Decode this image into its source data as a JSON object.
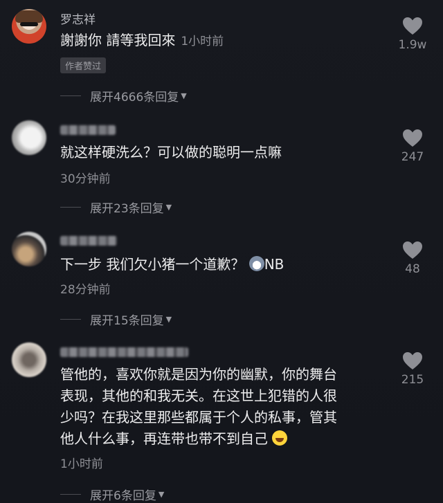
{
  "comments": [
    {
      "username": "罗志祥",
      "text": "謝謝你 請等我回來",
      "time": "1小时前",
      "badge": "作者赞过",
      "expand": "展开4666条回复",
      "likes": "1.9w"
    },
    {
      "username": "",
      "text": "就这样硬洗么？可以做的聪明一点嘛",
      "time": "30分钟前",
      "expand": "展开23条回复",
      "likes": "247"
    },
    {
      "username": "",
      "text": "下一步 我们欠小猪一个道歉？",
      "emoji_text": "NB",
      "time": "28分钟前",
      "expand": "展开15条回复",
      "likes": "48"
    },
    {
      "username": "",
      "lines": [
        "管他的，喜欢你就是因为你的幽默，你的舞台",
        "表现，其他的和我无关。在这世上犯错的人很",
        "少吗？在我这里那些都属于个人的私事，管其",
        "他人什么事，再连带也带不到自己"
      ],
      "time": "1小时前",
      "expand": "展开6条回复",
      "likes": "215"
    }
  ],
  "icons": {
    "like": "heart-icon",
    "expand_caret": "caret-down-icon",
    "emoji_wolf": "wolf-emoji-icon",
    "emoji_laugh": "laughing-emoji-icon"
  },
  "colors": {
    "background": "#15171d",
    "text_primary": "#ededee",
    "text_secondary": "#8f9096"
  }
}
